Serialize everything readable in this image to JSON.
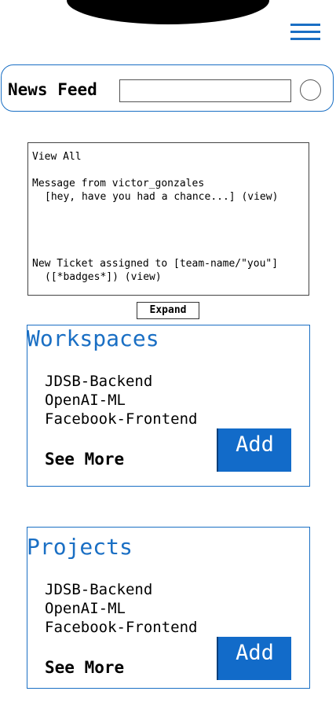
{
  "header": {
    "title": "News Feed",
    "search_value": "",
    "search_placeholder": ""
  },
  "notifications": {
    "view_all": "View All",
    "items": [
      {
        "heading": "Message from victor_gonzales",
        "detail": "[hey, have you had a chance...] (view)"
      },
      {
        "heading": "New Ticket assigned to [team-name/\"you\"]",
        "detail": "([*badges*]) (view)"
      }
    ],
    "expand_label": "Expand"
  },
  "workspaces": {
    "title": "Workspaces",
    "items": [
      "JDSB-Backend",
      "OpenAI-ML",
      "Facebook-Frontend"
    ],
    "see_more": "See More",
    "add_label": "Add"
  },
  "projects": {
    "title": "Projects",
    "items": [
      "JDSB-Backend",
      "OpenAI-ML",
      "Facebook-Frontend"
    ],
    "see_more": "See More",
    "add_label": "Add"
  },
  "colors": {
    "accent": "#1a6fc4",
    "button": "#126bc9"
  },
  "icons": {
    "menu": "hamburger-menu-icon",
    "search": "search-circle-icon"
  }
}
